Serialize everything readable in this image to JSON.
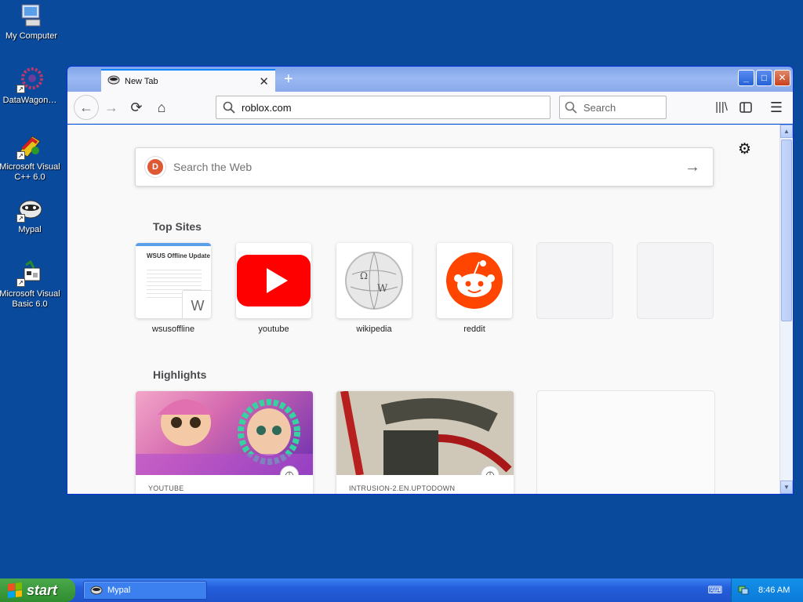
{
  "desktop": {
    "icons": [
      {
        "label": "My Computer"
      },
      {
        "label": "DataWagon…"
      },
      {
        "label": "Microsoft Visual C++ 6.0"
      },
      {
        "label": "Mypal"
      },
      {
        "label": "Microsoft Visual Basic 6.0"
      }
    ]
  },
  "browser": {
    "tab_title": "New Tab",
    "new_tab_symbol": "+",
    "url": "roblox.com",
    "search_placeholder": "Search",
    "websearch_placeholder": "Search the Web",
    "top_sites_heading": "Top Sites",
    "top_sites": [
      {
        "label": "wsusoffline",
        "thumb_title": "WSUS Offline Update",
        "badge": "W"
      },
      {
        "label": "youtube"
      },
      {
        "label": "wikipedia"
      },
      {
        "label": "reddit"
      },
      {
        "label": ""
      },
      {
        "label": ""
      }
    ],
    "highlights_heading": "Highlights",
    "highlights": [
      {
        "source": "YOUTUBE"
      },
      {
        "source": "INTRUSION-2.EN.UPTODOWN"
      },
      {
        "source": ""
      }
    ]
  },
  "taskbar": {
    "start_label": "start",
    "app_label": "Mypal",
    "clock": "8:46 AM"
  },
  "colors": {
    "desktop": "#0a4a9c",
    "accent": "#0a84ff",
    "youtube": "#ff0000",
    "reddit": "#ff4500"
  }
}
